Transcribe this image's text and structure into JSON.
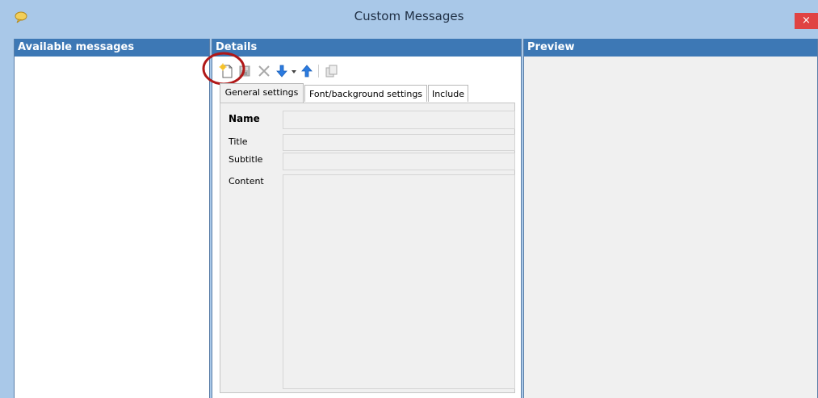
{
  "window": {
    "title": "Custom Messages",
    "close_label": "×",
    "app_icon": "speech-bubble-icon"
  },
  "panels": {
    "available": {
      "header": "Available messages"
    },
    "details": {
      "header": "Details"
    },
    "preview": {
      "header": "Preview"
    }
  },
  "toolbar": {
    "buttons": [
      {
        "name": "new-message",
        "icon": "new-document-icon",
        "enabled": true,
        "highlighted": true
      },
      {
        "name": "save",
        "icon": "save-icon",
        "enabled": false
      },
      {
        "name": "delete",
        "icon": "delete-x-icon",
        "enabled": false
      },
      {
        "name": "move-down",
        "icon": "arrow-down-icon",
        "enabled": true,
        "has_dropdown": true
      },
      {
        "name": "move-up",
        "icon": "arrow-up-icon",
        "enabled": true
      },
      {
        "name": "copy",
        "icon": "copy-icon",
        "enabled": false
      }
    ]
  },
  "tabs": [
    {
      "label": "General settings",
      "active": true
    },
    {
      "label": "Font/background settings",
      "active": false
    },
    {
      "label": "Include",
      "active": false
    }
  ],
  "form": {
    "name_label": "Name",
    "title_label": "Title",
    "subtitle_label": "Subtitle",
    "content_label": "Content",
    "name_value": "",
    "title_value": "",
    "subtitle_value": "",
    "content_value": ""
  },
  "colors": {
    "window_frame": "#a9c8e8",
    "panel_header": "#3d78b5",
    "close_button": "#e04343",
    "highlight_circle": "#b01818"
  }
}
